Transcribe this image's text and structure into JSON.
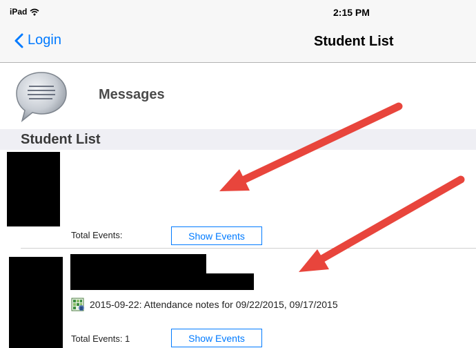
{
  "status_bar": {
    "device": "iPad",
    "time": "2:15 PM",
    "wifi_icon": "wifi-icon"
  },
  "nav": {
    "back_label": "Login",
    "back_icon": "chevron-left-icon",
    "title": "Student List",
    "tint_color": "#007aff"
  },
  "messages": {
    "label": "Messages",
    "icon": "speech-bubble-icon"
  },
  "section": {
    "title": "Student List"
  },
  "students": [
    {
      "total_events_label": "Total Events:",
      "show_events_label": "Show Events",
      "events": []
    },
    {
      "total_events_label": "Total Events: 1",
      "show_events_label": "Show Events",
      "events": [
        {
          "text": "2015-09-22: Attendance notes for 09/22/2015, 09/17/2015",
          "icon": "attendance-note-icon"
        }
      ]
    }
  ],
  "annotation": {
    "arrow_color": "#e8453c"
  }
}
